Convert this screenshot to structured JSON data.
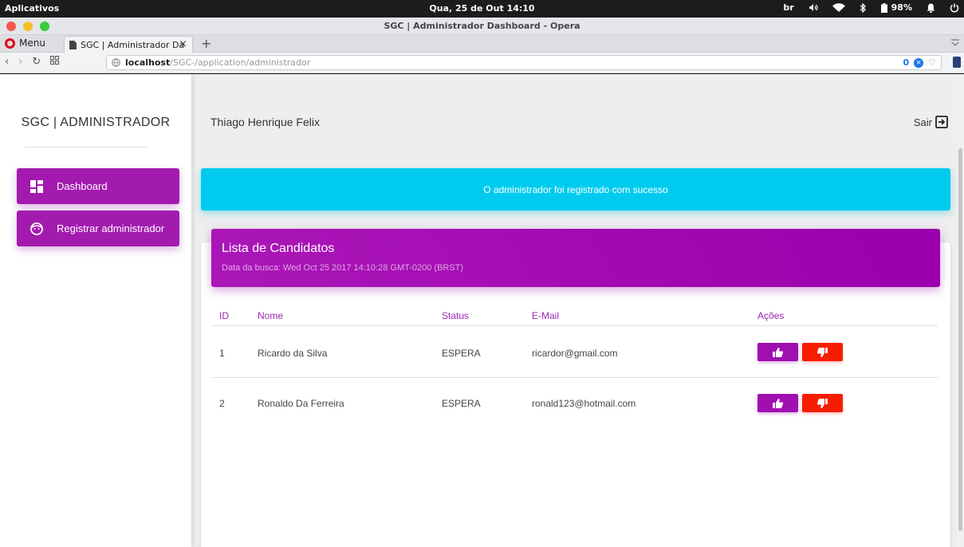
{
  "os": {
    "apps_label": "Aplicativos",
    "clock": "Qua, 25 de Out  14:10",
    "keyboard_layout": "br",
    "battery": "98%"
  },
  "browser": {
    "window_title": "SGC | Administrador Dashboard - Opera",
    "menu_label": "Menu",
    "tab_title": "SGC | Administrador Da",
    "url_host": "localhost",
    "url_path": "/SGC-/application/administrador",
    "blocked_count": "0",
    "traffic_colors": [
      "#f1584b",
      "#f5bf2c",
      "#3bca3b"
    ]
  },
  "sidebar": {
    "brand": "SGC | ADMINISTRADOR",
    "items": [
      {
        "label": "Dashboard",
        "icon": "dashboard-icon"
      },
      {
        "label": "Registrar administrador",
        "icon": "face-icon"
      }
    ]
  },
  "header": {
    "user_name": "Thiago Henrique Felix",
    "logout_label": "Sair"
  },
  "alert": {
    "message": "O administrador foi registrado com sucesso",
    "color": "#00cbef"
  },
  "card": {
    "title": "Lista de Candidatos",
    "subtitle": "Data da busca: Wed Oct 25 2017 14:10:28 GMT-0200 (BRST)",
    "accent": "#9c27b0"
  },
  "table": {
    "columns": [
      "ID",
      "Nome",
      "Status",
      "E-Mail",
      "Ações"
    ],
    "rows": [
      {
        "id": "1",
        "name": "Ricardo da Silva",
        "status": "ESPERA",
        "email": "ricardor@gmail.com"
      },
      {
        "id": "2",
        "name": "Ronaldo Da Ferreira",
        "status": "ESPERA",
        "email": "ronald123@hotmail.com"
      }
    ]
  }
}
